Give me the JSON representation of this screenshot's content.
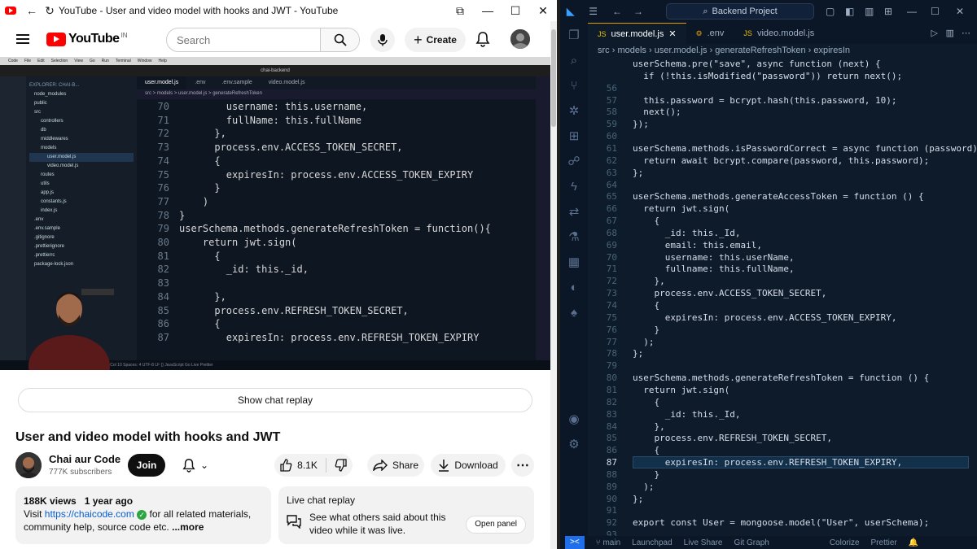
{
  "youtube": {
    "window_title": "YouTube - User and video model with hooks and JWT - YouTube",
    "logo_text": "YouTube",
    "logo_region": "IN",
    "search_placeholder": "Search",
    "create_label": "Create",
    "video": {
      "explorer_label": "EXPLORER: CHAI-B...",
      "title_bar": "chai-backend",
      "menubar": [
        "Code",
        "File",
        "Edit",
        "Selection",
        "View",
        "Go",
        "Run",
        "Terminal",
        "Window",
        "Help"
      ],
      "tree": [
        "node_modules",
        "public",
        "src",
        "controllers",
        "db",
        "middlewares",
        "models",
        "user.model.js",
        "video.model.js",
        "routes",
        "utils",
        "app.js",
        "constants.js",
        "index.js",
        ".env",
        ".env.sample",
        ".gitignore",
        ".prettierignore",
        ".prettierrc",
        "package-lock.json"
      ],
      "tabs": [
        "user.model.js",
        ".env",
        ".env.sample",
        "video.model.js"
      ],
      "breadcrumb": "src > models > user.model.js > generateRefreshToken",
      "lines": [
        {
          "n": "70",
          "t": "        username: this.username,"
        },
        {
          "n": "71",
          "t": "        fullName: this.fullName"
        },
        {
          "n": "72",
          "t": "      },"
        },
        {
          "n": "73",
          "t": "      process.env.ACCESS_TOKEN_SECRET,"
        },
        {
          "n": "74",
          "t": "      {"
        },
        {
          "n": "75",
          "t": "        expiresIn: process.env.ACCESS_TOKEN_EXPIRY"
        },
        {
          "n": "76",
          "t": "      }"
        },
        {
          "n": "77",
          "t": "    )"
        },
        {
          "n": "78",
          "t": "}"
        },
        {
          "n": "79",
          "t": "userSchema.methods.generateRefreshToken = function(){"
        },
        {
          "n": "80",
          "t": "    return jwt.sign("
        },
        {
          "n": "81",
          "t": "      {"
        },
        {
          "n": "82",
          "t": "        _id: this._id,"
        },
        {
          "n": "83",
          "t": ""
        },
        {
          "n": "84",
          "t": "      },"
        },
        {
          "n": "85",
          "t": "      process.env.REFRESH_TOKEN_SECRET,"
        },
        {
          "n": "86",
          "t": "      {"
        },
        {
          "n": "87",
          "t": "        expiresIn: process.env.REFRESH_TOKEN_EXPIRY"
        }
      ],
      "status": "Ln 88, Col 10   Spaces: 4   UTF-8   LF   {} JavaScript   Go Live   Prettier"
    },
    "show_chat_replay": "Show chat replay",
    "title": "User and video model with hooks and JWT",
    "channel": {
      "name": "Chai aur Code",
      "subscribers": "777K subscribers",
      "join_label": "Join"
    },
    "actions": {
      "likes": "8.1K",
      "share": "Share",
      "download": "Download"
    },
    "description": {
      "views": "188K views",
      "age": "1 year ago",
      "visit": "Visit",
      "link": "https://chaicode.com",
      "text": "for all related materials, community help, source code etc.",
      "more": "...more"
    },
    "live_chat": {
      "title": "Live chat replay",
      "body": "See what others said about this video while it was live.",
      "open_panel": "Open panel"
    }
  },
  "vscode": {
    "search_label": "Backend Project",
    "tabs": [
      {
        "label": "user.model.js",
        "active": true
      },
      {
        "label": ".env",
        "active": false
      },
      {
        "label": "video.model.js",
        "active": false
      }
    ],
    "breadcrumb": [
      "src",
      "models",
      "user.model.js",
      "generateRefreshToken",
      "expiresIn"
    ],
    "current_line": "87",
    "lines": [
      {
        "n": "",
        "t": "userSchema.pre(\"save\", async function (next) {"
      },
      {
        "n": "",
        "t": "  if (!this.isModified(\"password\")) return next();"
      },
      {
        "n": "56",
        "t": ""
      },
      {
        "n": "57",
        "t": "  this.password = bcrypt.hash(this.password, 10);"
      },
      {
        "n": "58",
        "t": "  next();"
      },
      {
        "n": "59",
        "t": "});"
      },
      {
        "n": "60",
        "t": ""
      },
      {
        "n": "61",
        "t": "userSchema.methods.isPasswordCorrect = async function (password) {"
      },
      {
        "n": "62",
        "t": "  return await bcrypt.compare(password, this.password);"
      },
      {
        "n": "63",
        "t": "};"
      },
      {
        "n": "64",
        "t": ""
      },
      {
        "n": "65",
        "t": "userSchema.methods.generateAccessToken = function () {"
      },
      {
        "n": "66",
        "t": "  return jwt.sign("
      },
      {
        "n": "67",
        "t": "    {"
      },
      {
        "n": "68",
        "t": "      _id: this._Id,"
      },
      {
        "n": "69",
        "t": "      email: this.email,"
      },
      {
        "n": "70",
        "t": "      username: this.userName,"
      },
      {
        "n": "71",
        "t": "      fullname: this.fullName,"
      },
      {
        "n": "72",
        "t": "    },"
      },
      {
        "n": "73",
        "t": "    process.env.ACCESS_TOKEN_SECRET,"
      },
      {
        "n": "74",
        "t": "    {"
      },
      {
        "n": "75",
        "t": "      expiresIn: process.env.ACCESS_TOKEN_EXPIRY,"
      },
      {
        "n": "76",
        "t": "    }"
      },
      {
        "n": "77",
        "t": "  );"
      },
      {
        "n": "78",
        "t": "};"
      },
      {
        "n": "79",
        "t": ""
      },
      {
        "n": "80",
        "t": "userSchema.methods.generateRefreshToken = function () {"
      },
      {
        "n": "81",
        "t": "  return jwt.sign("
      },
      {
        "n": "82",
        "t": "    {"
      },
      {
        "n": "83",
        "t": "      _id: this._Id,"
      },
      {
        "n": "84",
        "t": "    },"
      },
      {
        "n": "85",
        "t": "    process.env.REFRESH_TOKEN_SECRET,"
      },
      {
        "n": "86",
        "t": "    {"
      },
      {
        "n": "87",
        "t": "      expiresIn: process.env.REFRESH_TOKEN_EXPIRY,"
      },
      {
        "n": "88",
        "t": "    }"
      },
      {
        "n": "89",
        "t": "  );"
      },
      {
        "n": "90",
        "t": "};"
      },
      {
        "n": "91",
        "t": ""
      },
      {
        "n": "92",
        "t": "export const User = mongoose.model(\"User\", userSchema);"
      },
      {
        "n": "93",
        "t": ""
      }
    ],
    "status": {
      "branch": "main",
      "items": [
        "Launchpad",
        "Live Share",
        "Git Graph"
      ],
      "right": [
        "Colorize",
        "Prettier"
      ]
    },
    "colors": {
      "accent": "#1f6feb",
      "background": "#0d1b2a"
    }
  }
}
